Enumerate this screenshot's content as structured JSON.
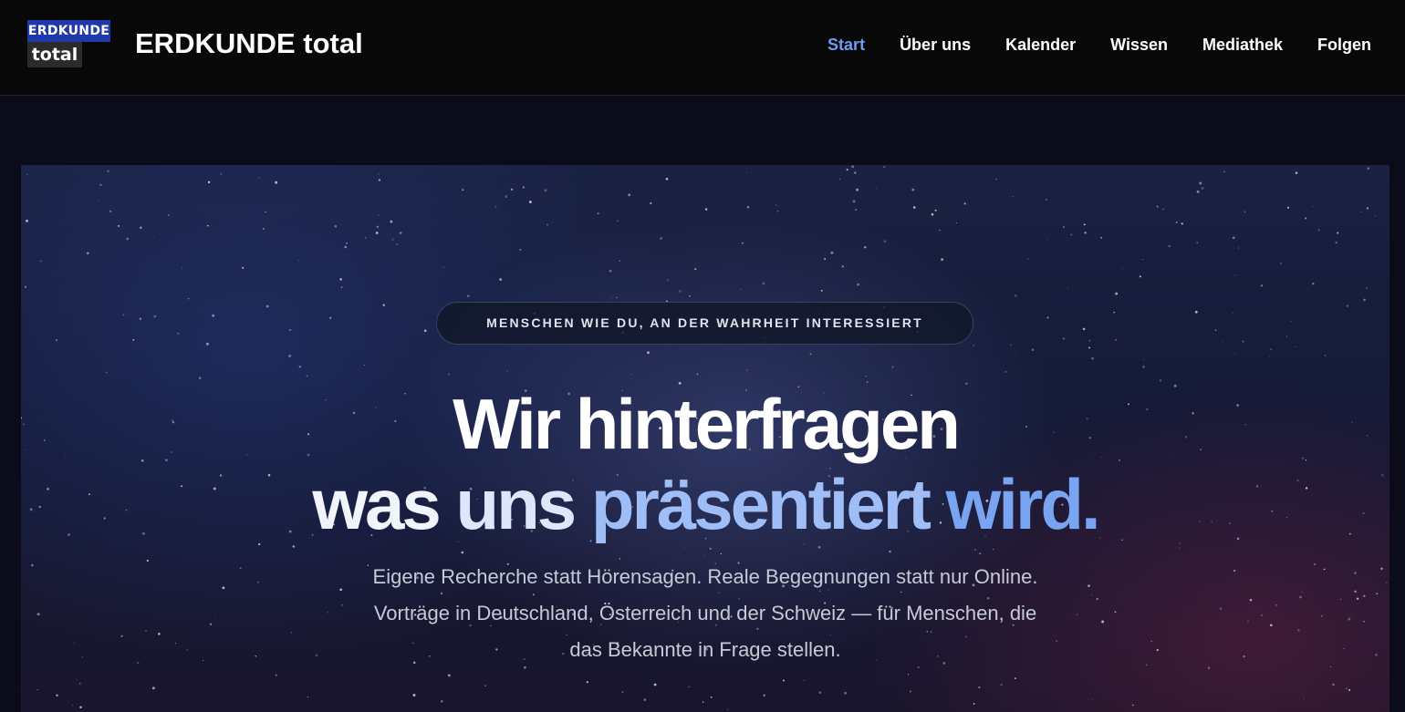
{
  "header": {
    "logo_top": "ERDKUNDE",
    "logo_bottom": "total",
    "site_title": "ERDKUNDE total",
    "nav": [
      {
        "label": "Start",
        "active": true
      },
      {
        "label": "Über uns",
        "active": false
      },
      {
        "label": "Kalender",
        "active": false
      },
      {
        "label": "Wissen",
        "active": false
      },
      {
        "label": "Mediathek",
        "active": false
      },
      {
        "label": "Folgen",
        "active": false
      }
    ]
  },
  "hero": {
    "badge": "MENSCHEN WIE DU, AN DER WAHRHEIT INTERESSIERT",
    "headline_line1": "Wir hinterfragen",
    "headline_line2_a": "was ",
    "headline_line2_b": "uns ",
    "headline_line2_c": "präsentiert ",
    "headline_line2_d": "wird.",
    "sub_line1": "Eigene Recherche statt Hörensagen. Reale Begegnungen statt nur Online.",
    "sub_line2": "Vorträge in Deutschland, Österreich und der Schweiz — für Menschen, die",
    "sub_line3": "das Bekannte in Frage stellen."
  },
  "colors": {
    "header_bg": "#080808",
    "nav_active": "#6d9cf0",
    "logo_blue": "#1f3aa8",
    "accent_light_blue": "#78a4f2"
  }
}
